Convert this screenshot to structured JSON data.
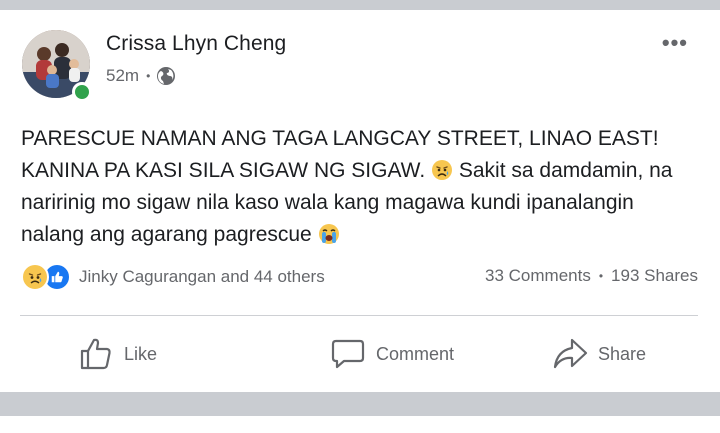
{
  "post": {
    "author": "Crissa Lhyn Cheng",
    "time": "52m",
    "separator": "•",
    "privacy_icon": "globe-icon",
    "more_icon": "more-options-icon",
    "more_glyph": "•••",
    "text_lines": [
      "PARESCUE NAMAN ANG TAGA LANGCAY STREET, LINAO EAST!",
      "KANINA PA KASI SILA SIGAW NG SIGAW.",
      "Sakit sa damdamin, na naririnig mo sigaw nila kaso wala kang magawa kundi ipanalangin nalang ang agarang pagrescue"
    ],
    "emoji_1": "sad-tear-emoji",
    "emoji_2": "crying-emoji"
  },
  "reactions": {
    "icons": [
      "sad-reaction-icon",
      "like-reaction-icon"
    ],
    "summary": "Jinky Cagurangan and 44 others",
    "comments": "33 Comments",
    "shares": "193 Shares",
    "separator": "•"
  },
  "actions": {
    "like": "Like",
    "comment": "Comment",
    "share": "Share"
  },
  "colors": {
    "text": "#1c1e21",
    "secondary": "#65676b",
    "online": "#31a24c",
    "like_blue": "#1877f2",
    "sad_yellow": "#f7c64f",
    "divider": "#ced0d4",
    "feed_bg": "#c9ccd1"
  }
}
